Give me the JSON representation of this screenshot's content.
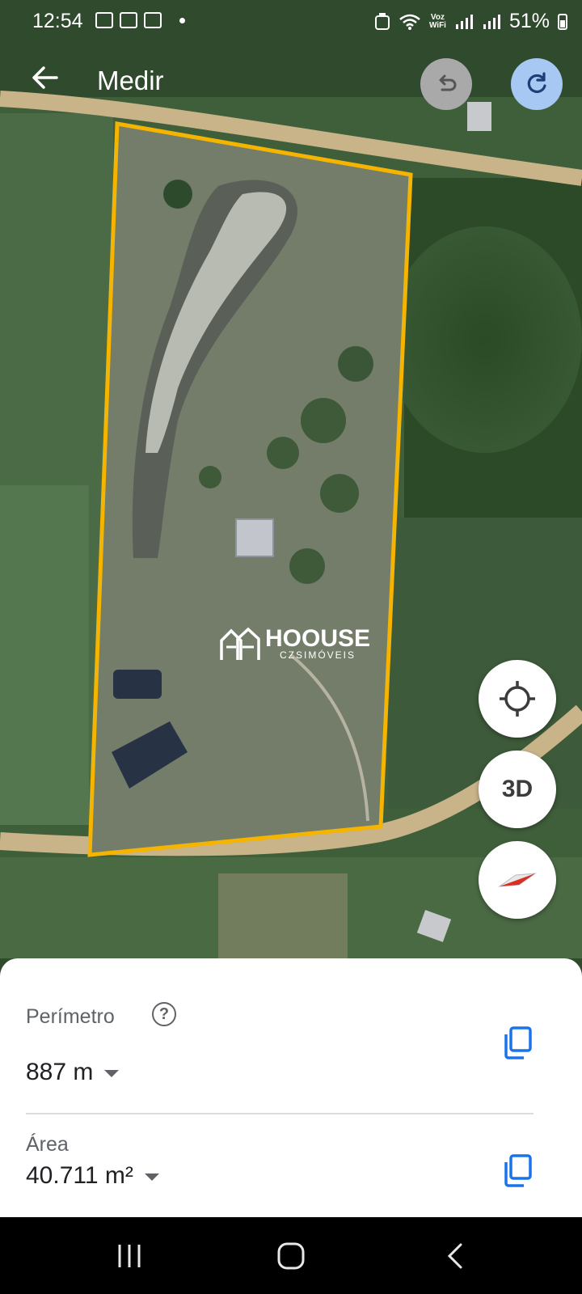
{
  "status_bar": {
    "time": "12:54",
    "network_label": "Voz\nWiFi",
    "battery": "51%"
  },
  "toolbar": {
    "back_icon": "arrow-back-icon",
    "title": "Medir",
    "undo_icon": "undo-icon",
    "redo_icon": "redo-icon"
  },
  "watermark": {
    "brand": "HOOUSE",
    "sub": "CZSIMÓVEIS"
  },
  "map_controls": {
    "locate_icon": "crosshair-icon",
    "three_d_label": "3D",
    "compass_icon": "compass-icon"
  },
  "measurement": {
    "perimeter_label": "Perímetro",
    "perimeter_value": "887 m",
    "area_label": "Área",
    "area_value": "40.711 m²",
    "help_icon": "help-icon",
    "copy_icon": "copy-icon"
  },
  "colors": {
    "polygon": "#f4b400",
    "road": "#c9b48a",
    "accent_blue": "#1a73e8"
  }
}
